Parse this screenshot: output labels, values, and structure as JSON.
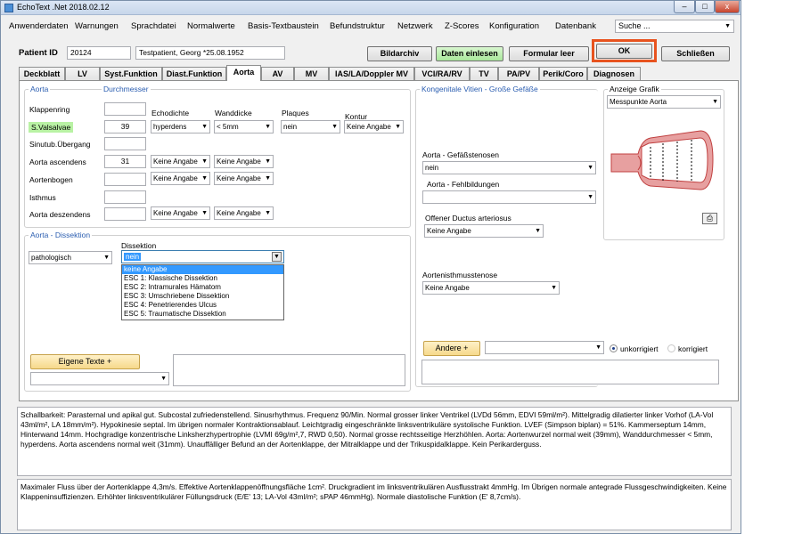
{
  "window": {
    "title": "EchoText .Net 2018.02.12",
    "btn_min": "–",
    "btn_max": "□",
    "btn_close": "x"
  },
  "menu": {
    "items": [
      "Anwenderdaten",
      "Warnungen",
      "Sprachdatei",
      "Normalwerte",
      "Basis-Textbaustein",
      "Befundstruktur",
      "Netzwerk",
      "Z-Scores",
      "Konfiguration",
      "Datenbank"
    ],
    "search_value": "Suche ..."
  },
  "patient": {
    "label": "Patient ID",
    "id": "20124",
    "name": "Testpatient, Georg *25.08.1952"
  },
  "buttons": {
    "bildarchiv": "Bildarchiv",
    "daten_einlesen": "Daten einlesen",
    "formular_leer": "Formular leer",
    "ok": "OK",
    "schliessen": "Schließen"
  },
  "tabs": [
    "Deckblatt",
    "LV",
    "Syst.Funktion",
    "Diast.Funktion",
    "Aorta",
    "AV",
    "MV",
    "IAS/LA/Doppler MV",
    "VCI/RA/RV",
    "TV",
    "PA/PV",
    "Perik/Coro",
    "Diagnosen"
  ],
  "aorta": {
    "title": "Aorta",
    "durchmesser": "Durchmesser",
    "col_echodichte": "Echodichte",
    "col_wanddicke": "Wanddicke",
    "col_plaques": "Plaques",
    "col_kontur": "Kontur",
    "rows": [
      {
        "label": "Klappenring",
        "value": ""
      },
      {
        "label": "S.Valsalvae",
        "value": "39",
        "echo": "hyperdens",
        "wand": "< 5mm",
        "plaques": "nein",
        "kontur": "Keine Angabe"
      },
      {
        "label": "Sinutub.Übergang",
        "value": ""
      },
      {
        "label": "Aorta ascendens",
        "value": "31",
        "echo": "Keine Angabe",
        "wand": "Keine Angabe"
      },
      {
        "label": "Aortenbogen",
        "value": "",
        "echo": "Keine Angabe",
        "wand": "Keine Angabe"
      },
      {
        "label": "Isthmus",
        "value": ""
      },
      {
        "label": "Aorta deszendens",
        "value": "",
        "echo": "Keine Angabe",
        "wand": "Keine Angabe"
      }
    ]
  },
  "dissektion": {
    "title": "Aorta  -  Dissektion",
    "left_value": "pathologisch",
    "label": "Dissektion",
    "value": "nein",
    "options": [
      "keine Angabe",
      "ESC 1: Klassische Dissektion",
      "ESC 2: Intramurales Hämatom",
      "ESC 3: Umschriebene Dissektion",
      "ESC 4: Penetrierendes Ulcus",
      "ESC 5: Traumatische Dissektion"
    ]
  },
  "eigene": {
    "button": "Eigene Texte +",
    "dropdown_value": "",
    "text": ""
  },
  "kongenital": {
    "title": "Kongenitale Vitien - Große Gefäße",
    "stenosen_label": "Aorta - Gefäßstenosen",
    "stenosen_value": "nein",
    "fehlbildungen_label": "Aorta  - Fehlbildungen",
    "fehlbildungen_value": "",
    "ductus_label": "Offener Ductus arteriosus",
    "ductus_value": "Keine Angabe",
    "isthmus_label": "Aortenisthmusstenose",
    "isthmus_value": "Keine Angabe",
    "andere_button": "Andere +",
    "andere_value": "",
    "radio_unkorr": "unkorrigiert",
    "radio_korr": "korrigiert",
    "radio_selected": "unkorrigiert",
    "andere_text": ""
  },
  "grafik": {
    "label": "Anzeige Grafik",
    "value": "Messpunkte Aorta",
    "colors": {
      "vessel": "#e07070",
      "wall": "#c04040"
    }
  },
  "report1": "Schallbarkeit: Parasternal und apikal gut. Subcostal zufriedenstellend. Sinusrhythmus. Frequenz 90/Min. Normal grosser linker Ventrikel (LVDd 56mm, EDVI 59ml/m²). Mittelgradig dilatierter linker Vorhof (LA-Vol 43ml/m², LA 18mm/m²). Hypokinesie septal. Im übrigen normaler Kontraktionsablauf. Leichtgradig eingeschränkte linksventrikuläre systolische Funktion. LVEF (Simpson biplan) = 51%. Kammerseptum 14mm, Hinterwand 14mm. Hochgradige konzentrische Linksherzhypertrophie (LVMI 69g/m²,7, RWD 0,50). Normal grosse rechtsseitige Herzhöhlen. Aorta: Aortenwurzel normal weit (39mm), Wanddurchmesser < 5mm, hyperdens. Aorta ascendens normal weit (31mm). Unauffälliger Befund an der Aortenklappe, der Mitralklappe und der Trikuspidalklappe. Kein Perikarderguss.",
  "report2": "Maximaler Fluss über der Aortenklappe 4,3m/s. Effektive Aortenklappenöffnungsfläche 1cm². Druckgradient im linksventrikulären Ausflusstrakt 4mmHg. Im Übrigen normale antegrade Flussgeschwindigkeiten. Keine Klappeninsuffizienzen. Erhöhter linksventrikulärer Füllungsdruck (E/E' 13; LA-Vol 43ml/m²; sPAP 46mmHg). Normale diastolische Funktion (E' 8,7cm/s)."
}
